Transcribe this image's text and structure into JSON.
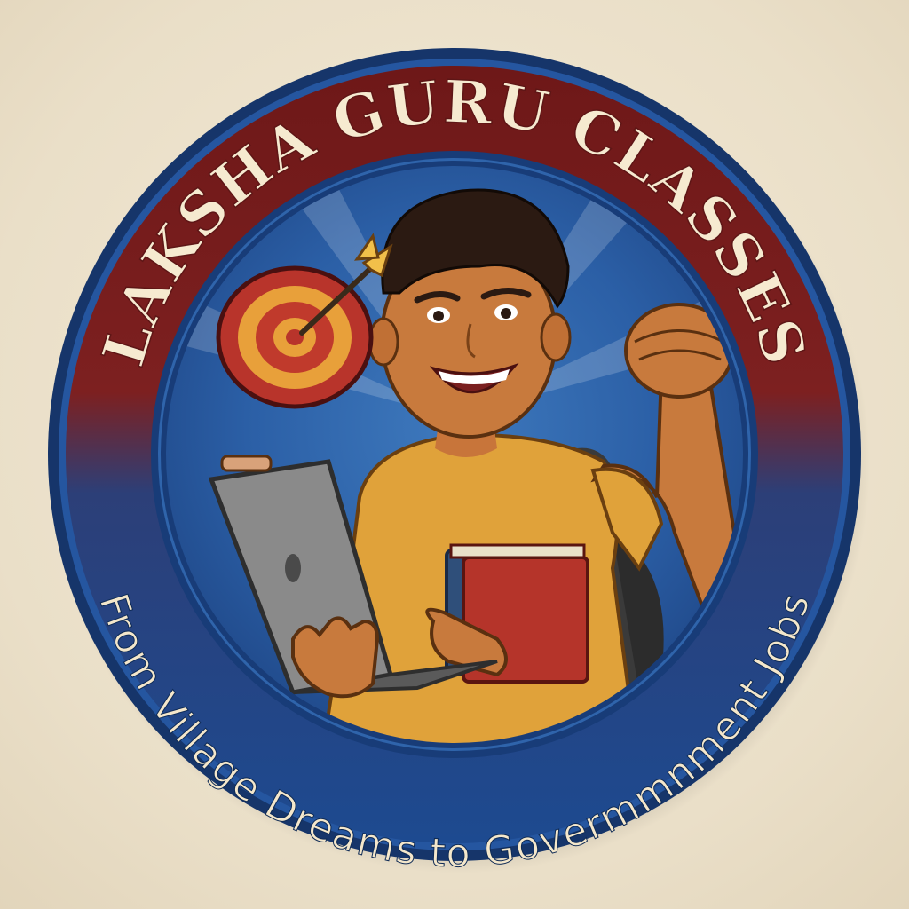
{
  "badge": {
    "title": "LAKSHA GURU CLASSES",
    "tagline": "From Village Dreams to Govermmnment Jobs",
    "colors": {
      "background": "#ece2cc",
      "outer_rim": "#1c3f7a",
      "title_band": "#7a1d1d",
      "tagline_band": "#1f4a8f",
      "inner_field": "#2a5aa0",
      "text": "#f6ead0"
    },
    "illustration": {
      "figure": "smiling-student",
      "props": [
        "target-with-arrow-icon",
        "laptop",
        "books",
        "backpack",
        "raised-fist"
      ]
    }
  }
}
